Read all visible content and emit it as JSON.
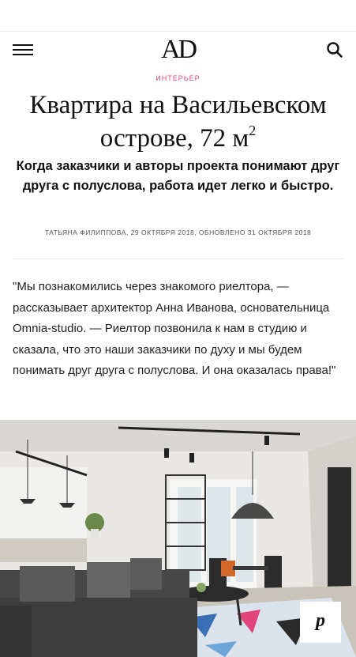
{
  "header": {
    "logo": "AD",
    "menu_icon": "hamburger-menu-icon",
    "search_icon": "search-icon"
  },
  "article": {
    "category": "ИНТЕРЬЕР",
    "title_main": "Квартира на Васильевском острове, 72 м",
    "title_sup": "2",
    "lead": "Когда заказчики и авторы проекта понимают друг друга с полуслова, работа идет легко и быстро.",
    "meta": "ТАТЬЯНА ФИЛИППОВА,  29 ОКТЯБРЯ 2018, ОБНОВЛЕНО 31 ОКТЯБРЯ 2018",
    "body": "\"Мы познакомились через знакомого риелтора, — рассказывает архитектор Анна Иванова, основательница Omnia-studio. — Риелтор позвонила к нам в студию и сказала, что это наши заказчики по духу и мы будем понимать друг друга с полуслова. И она оказалась права!\""
  },
  "photo": {
    "pin_icon": "pinterest-icon",
    "pin_glyph": "p"
  },
  "colors": {
    "accent": "#e0457b",
    "text": "#111111",
    "divider": "#e6e6e6"
  }
}
